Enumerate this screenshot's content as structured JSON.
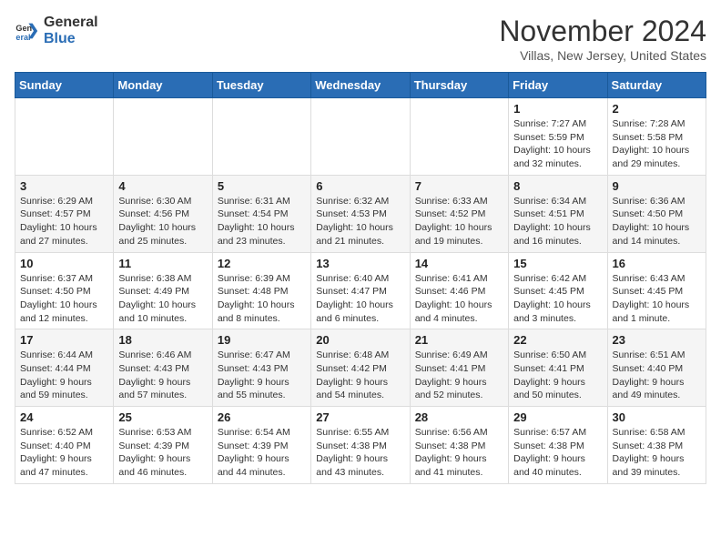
{
  "logo": {
    "text_general": "General",
    "text_blue": "Blue"
  },
  "title": "November 2024",
  "location": "Villas, New Jersey, United States",
  "days_of_week": [
    "Sunday",
    "Monday",
    "Tuesday",
    "Wednesday",
    "Thursday",
    "Friday",
    "Saturday"
  ],
  "weeks": [
    [
      {
        "day": "",
        "info": ""
      },
      {
        "day": "",
        "info": ""
      },
      {
        "day": "",
        "info": ""
      },
      {
        "day": "",
        "info": ""
      },
      {
        "day": "",
        "info": ""
      },
      {
        "day": "1",
        "info": "Sunrise: 7:27 AM\nSunset: 5:59 PM\nDaylight: 10 hours and 32 minutes."
      },
      {
        "day": "2",
        "info": "Sunrise: 7:28 AM\nSunset: 5:58 PM\nDaylight: 10 hours and 29 minutes."
      }
    ],
    [
      {
        "day": "3",
        "info": "Sunrise: 6:29 AM\nSunset: 4:57 PM\nDaylight: 10 hours and 27 minutes."
      },
      {
        "day": "4",
        "info": "Sunrise: 6:30 AM\nSunset: 4:56 PM\nDaylight: 10 hours and 25 minutes."
      },
      {
        "day": "5",
        "info": "Sunrise: 6:31 AM\nSunset: 4:54 PM\nDaylight: 10 hours and 23 minutes."
      },
      {
        "day": "6",
        "info": "Sunrise: 6:32 AM\nSunset: 4:53 PM\nDaylight: 10 hours and 21 minutes."
      },
      {
        "day": "7",
        "info": "Sunrise: 6:33 AM\nSunset: 4:52 PM\nDaylight: 10 hours and 19 minutes."
      },
      {
        "day": "8",
        "info": "Sunrise: 6:34 AM\nSunset: 4:51 PM\nDaylight: 10 hours and 16 minutes."
      },
      {
        "day": "9",
        "info": "Sunrise: 6:36 AM\nSunset: 4:50 PM\nDaylight: 10 hours and 14 minutes."
      }
    ],
    [
      {
        "day": "10",
        "info": "Sunrise: 6:37 AM\nSunset: 4:50 PM\nDaylight: 10 hours and 12 minutes."
      },
      {
        "day": "11",
        "info": "Sunrise: 6:38 AM\nSunset: 4:49 PM\nDaylight: 10 hours and 10 minutes."
      },
      {
        "day": "12",
        "info": "Sunrise: 6:39 AM\nSunset: 4:48 PM\nDaylight: 10 hours and 8 minutes."
      },
      {
        "day": "13",
        "info": "Sunrise: 6:40 AM\nSunset: 4:47 PM\nDaylight: 10 hours and 6 minutes."
      },
      {
        "day": "14",
        "info": "Sunrise: 6:41 AM\nSunset: 4:46 PM\nDaylight: 10 hours and 4 minutes."
      },
      {
        "day": "15",
        "info": "Sunrise: 6:42 AM\nSunset: 4:45 PM\nDaylight: 10 hours and 3 minutes."
      },
      {
        "day": "16",
        "info": "Sunrise: 6:43 AM\nSunset: 4:45 PM\nDaylight: 10 hours and 1 minute."
      }
    ],
    [
      {
        "day": "17",
        "info": "Sunrise: 6:44 AM\nSunset: 4:44 PM\nDaylight: 9 hours and 59 minutes."
      },
      {
        "day": "18",
        "info": "Sunrise: 6:46 AM\nSunset: 4:43 PM\nDaylight: 9 hours and 57 minutes."
      },
      {
        "day": "19",
        "info": "Sunrise: 6:47 AM\nSunset: 4:43 PM\nDaylight: 9 hours and 55 minutes."
      },
      {
        "day": "20",
        "info": "Sunrise: 6:48 AM\nSunset: 4:42 PM\nDaylight: 9 hours and 54 minutes."
      },
      {
        "day": "21",
        "info": "Sunrise: 6:49 AM\nSunset: 4:41 PM\nDaylight: 9 hours and 52 minutes."
      },
      {
        "day": "22",
        "info": "Sunrise: 6:50 AM\nSunset: 4:41 PM\nDaylight: 9 hours and 50 minutes."
      },
      {
        "day": "23",
        "info": "Sunrise: 6:51 AM\nSunset: 4:40 PM\nDaylight: 9 hours and 49 minutes."
      }
    ],
    [
      {
        "day": "24",
        "info": "Sunrise: 6:52 AM\nSunset: 4:40 PM\nDaylight: 9 hours and 47 minutes."
      },
      {
        "day": "25",
        "info": "Sunrise: 6:53 AM\nSunset: 4:39 PM\nDaylight: 9 hours and 46 minutes."
      },
      {
        "day": "26",
        "info": "Sunrise: 6:54 AM\nSunset: 4:39 PM\nDaylight: 9 hours and 44 minutes."
      },
      {
        "day": "27",
        "info": "Sunrise: 6:55 AM\nSunset: 4:38 PM\nDaylight: 9 hours and 43 minutes."
      },
      {
        "day": "28",
        "info": "Sunrise: 6:56 AM\nSunset: 4:38 PM\nDaylight: 9 hours and 41 minutes."
      },
      {
        "day": "29",
        "info": "Sunrise: 6:57 AM\nSunset: 4:38 PM\nDaylight: 9 hours and 40 minutes."
      },
      {
        "day": "30",
        "info": "Sunrise: 6:58 AM\nSunset: 4:38 PM\nDaylight: 9 hours and 39 minutes."
      }
    ]
  ]
}
